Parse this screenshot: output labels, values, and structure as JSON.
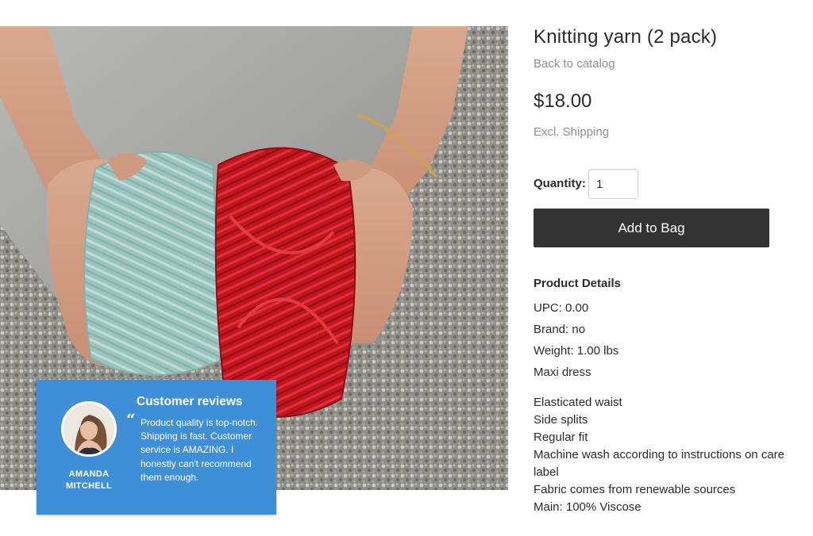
{
  "product": {
    "title": "Knitting yarn (2 pack)",
    "back_link": "Back to catalog",
    "price": "$18.00",
    "shipping_note": "Excl. Shipping",
    "quantity_label": "Quantity:",
    "quantity_value": "1",
    "add_button_label": "Add to Bag",
    "details_heading": "Product Details",
    "specs": [
      "UPC: 0.00",
      "Brand: no",
      "Weight: 1.00 lbs",
      "Maxi dress"
    ],
    "description": [
      "Elasticated waist",
      "Side splits",
      "Regular fit",
      "Machine wash according to instructions on care label",
      "Fabric comes from renewable sources",
      "Main: 100% Viscose"
    ]
  },
  "review": {
    "title": "Customer reviews",
    "quote_mark": "“",
    "text": "Product quality is top-notch. Shipping is fast. Customer service is AMAZING. I honestly can't recommend them enough.",
    "author_line1": "AMANDA",
    "author_line2": "MITCHELL"
  },
  "colors": {
    "review_card": "#3f8fd6",
    "add_button": "#333333",
    "muted_text": "#8e8e8e",
    "yarn_left": "#9fc7c2",
    "yarn_right": "#c8141d"
  },
  "icons": {
    "review_quote": "quote-icon"
  }
}
